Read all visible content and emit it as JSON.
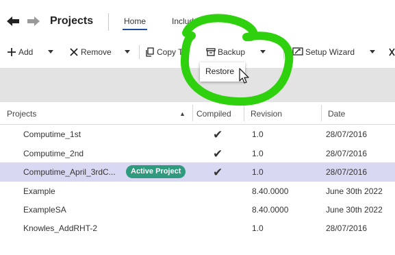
{
  "header": {
    "title": "Projects",
    "tabs": [
      {
        "label": "Home"
      },
      {
        "label": "Includes"
      }
    ]
  },
  "toolbar": {
    "add_label": "Add",
    "remove_label": "Remove",
    "copy_to_label": "Copy To",
    "backup_label": "Backup",
    "setup_wizard_label": "Setup Wizard"
  },
  "backup_menu": {
    "items": [
      {
        "label": "Restore"
      }
    ]
  },
  "table": {
    "columns": [
      "Projects",
      "Compiled",
      "Revision",
      "Date"
    ],
    "sort_indicator": "▲",
    "rows": [
      {
        "name": "Computime_1st",
        "compiled": "✔",
        "revision": "1.0",
        "date": "28/07/2016",
        "badge": ""
      },
      {
        "name": "Computime_2nd",
        "compiled": "✔",
        "revision": "1.0",
        "date": "28/07/2016",
        "badge": ""
      },
      {
        "name": "Computime_April_3rdC...",
        "compiled": "✔",
        "revision": "1.0",
        "date": "28/07/2016",
        "badge": "Active Project"
      },
      {
        "name": "Example",
        "compiled": "",
        "revision": "8.40.0000",
        "date": "June 30th 2022",
        "badge": ""
      },
      {
        "name": "ExampleSA",
        "compiled": "",
        "revision": "8.40.0000",
        "date": "June 30th 2022",
        "badge": ""
      },
      {
        "name": "Knowles_AddRHT-2",
        "compiled": "",
        "revision": "1.0",
        "date": "28/07/2016",
        "badge": ""
      }
    ]
  },
  "colors": {
    "selected_row": "#d9d8f2",
    "badge": "#2f9a7d",
    "annotation": "#2fd10f",
    "tab_underline": "#1f4aa8"
  }
}
